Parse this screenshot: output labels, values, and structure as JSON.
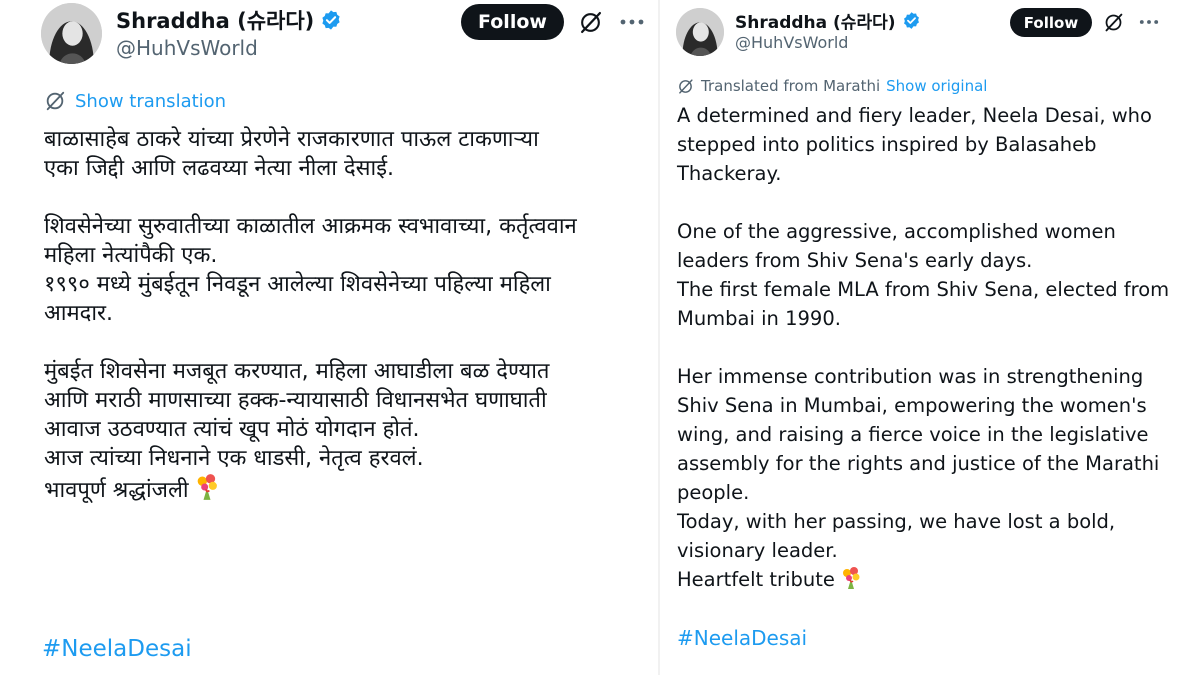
{
  "left_tweet": {
    "author": {
      "name": "Shraddha (슈라다)",
      "handle": "@HuhVsWorld",
      "verified_icon": "verified-badge-icon"
    },
    "follow_label": "Follow",
    "show_translation_label": "Show translation",
    "body_lines": [
      "बाळासाहेब ठाकरे यांच्या प्रेरणेने राजकारणात पाऊल टाकणाऱ्या",
      "एका जिद्दी आणि लढवय्या नेत्या नीला देसाई.",
      "",
      "शिवसेनेच्या सुरुवातीच्या काळातील आक्रमक स्वभावाच्या, कर्तृत्ववान",
      "महिला नेत्यांपैकी एक.",
      "१९९० मध्ये मुंबईतून निवडून आलेल्या शिवसेनेच्या पहिल्या महिला",
      "आमदार.",
      "",
      "मुंबईत शिवसेना मजबूत करण्यात, महिला आघाडीला बळ देण्यात",
      "आणि मराठी माणसाच्या हक्क-न्यायासाठी विधानसभेत घणाघाती",
      "आवाज उठवण्यात त्यांचं खूप मोठं योगदान होतं.",
      "आज त्यांच्या निधनाने एक धाडसी, नेतृत्व हरवलं.",
      "भावपूर्ण श्रद्धांजली"
    ],
    "hashtag": "#NeelaDesai"
  },
  "right_tweet": {
    "author": {
      "name": "Shraddha (슈라다)",
      "handle": "@HuhVsWorld",
      "verified_icon": "verified-badge-icon"
    },
    "follow_label": "Follow",
    "translated_from_label": "Translated from Marathi",
    "show_original_label": "Show original",
    "body_lines": [
      "A determined and fiery leader, Neela Desai, who",
      "stepped into politics inspired by Balasaheb",
      "Thackeray.",
      "",
      "One of the aggressive, accomplished women",
      "leaders from Shiv Sena's early days.",
      "The first female MLA from Shiv Sena, elected from",
      "Mumbai in 1990.",
      "",
      "Her immense contribution was in strengthening",
      "Shiv Sena in Mumbai, empowering the women's",
      "wing, and raising a fierce voice in the legislative",
      "assembly for the rights and justice of the Marathi",
      "people.",
      "Today, with her passing, we have lost a bold,",
      "visionary leader.",
      "Heartfelt tribute"
    ],
    "hashtag": "#NeelaDesai"
  },
  "icons": {
    "grok": "grok-icon",
    "more": "more-options-icon",
    "translate": "translate-icon",
    "bouquet_emoji": "bouquet-emoji-icon"
  },
  "colors": {
    "link": "#1d9bf0",
    "text": "#0f1419",
    "secondary": "#536471",
    "button_bg": "#0f1419"
  }
}
